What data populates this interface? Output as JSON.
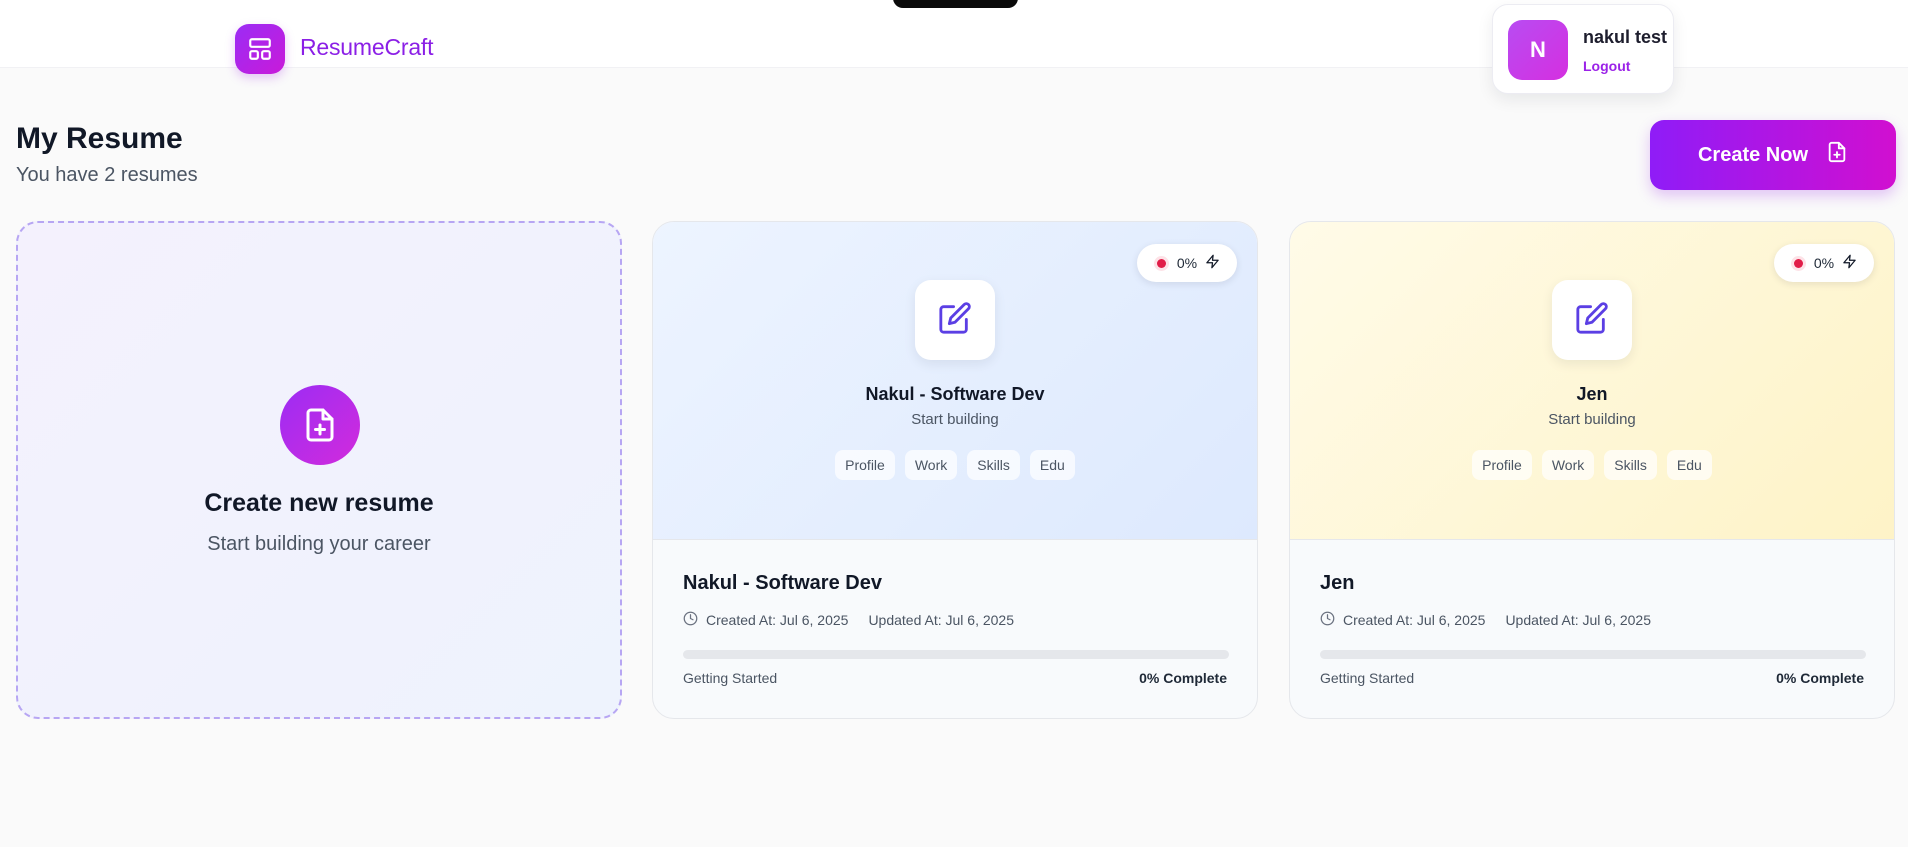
{
  "header": {
    "app_name": "ResumeCraft"
  },
  "user": {
    "initial": "N",
    "name": "nakul test",
    "logout_label": "Logout"
  },
  "page": {
    "title": "My Resume",
    "subtitle": "You have 2 resumes",
    "create_button_label": "Create Now"
  },
  "new_resume_card": {
    "title": "Create new resume",
    "subtitle": "Start building your career"
  },
  "resumes": [
    {
      "title": "Nakul - Software Dev",
      "preview_subtitle": "Start building",
      "completion_badge": "0%",
      "tags": [
        "Profile",
        "Work",
        "Skills",
        "Edu"
      ],
      "created": "Created At: Jul 6, 2025",
      "updated": "Updated At: Jul 6, 2025",
      "status": "Getting Started",
      "complete_label": "0% Complete",
      "progress": 0,
      "theme": "blue"
    },
    {
      "title": "Jen",
      "preview_subtitle": "Start building",
      "completion_badge": "0%",
      "tags": [
        "Profile",
        "Work",
        "Skills",
        "Edu"
      ],
      "created": "Created At: Jul 6, 2025",
      "updated": "Updated At: Jul 6, 2025",
      "status": "Getting Started",
      "complete_label": "0% Complete",
      "progress": 0,
      "theme": "yellow"
    }
  ],
  "colors": {
    "brand": "#8b1fe6",
    "accent_gradient_start": "#8f1cf7",
    "accent_gradient_end": "#d10fd0",
    "status_dot": "#e11d48"
  },
  "icons": {
    "logo": "layout-grid-icon",
    "create_button": "file-plus-icon",
    "new_resume": "file-plus-icon",
    "edit": "pencil-square-icon",
    "badge_status": "record-dot-icon",
    "badge_action": "lightning-icon",
    "dates": "clock-icon"
  }
}
